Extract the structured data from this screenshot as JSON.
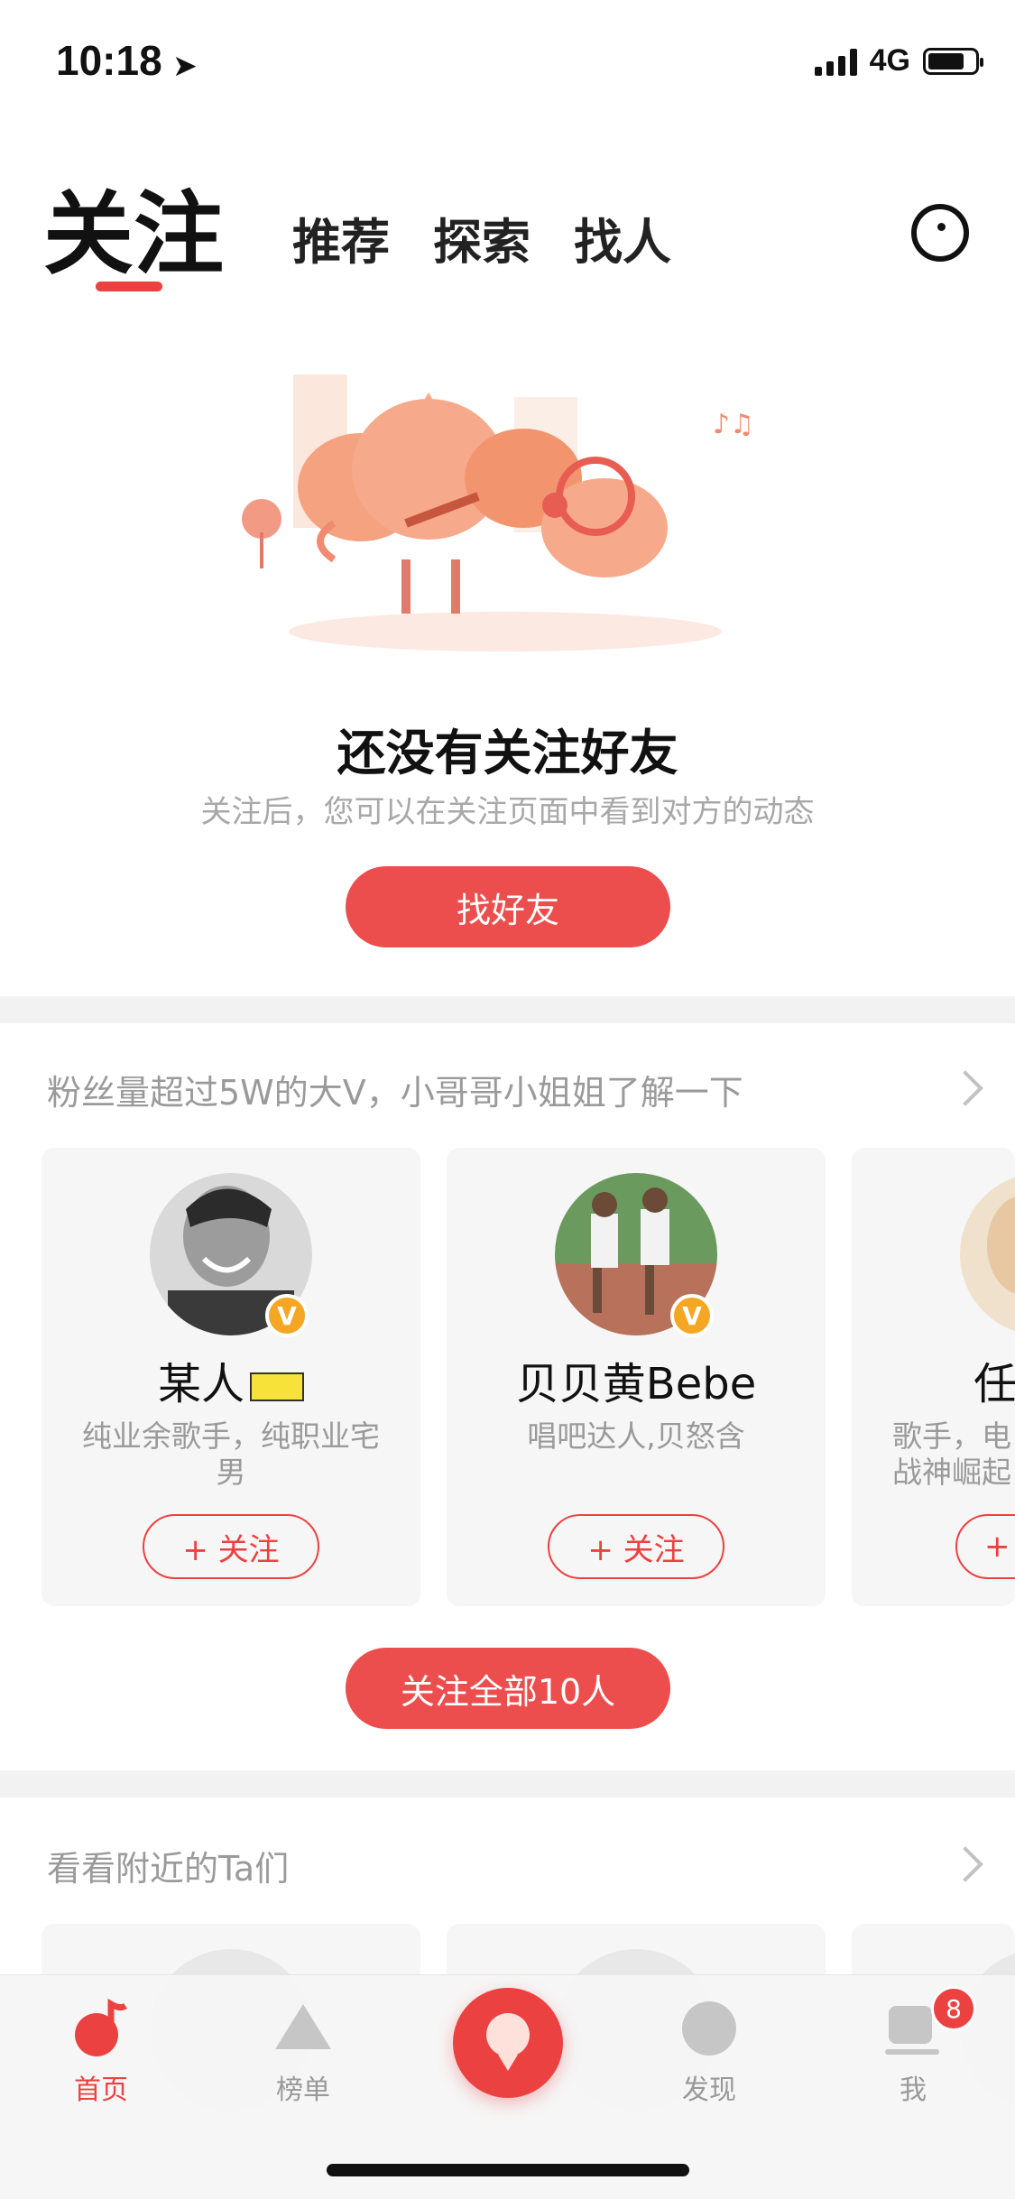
{
  "status_bar": {
    "time": "10:18",
    "network": "4G",
    "battery_level": 0.7
  },
  "tabs": {
    "active": "关注",
    "items": [
      "推荐",
      "探索",
      "找人"
    ]
  },
  "empty_state": {
    "title": "还没有关注好友",
    "subtitle": "关注后，您可以在关注页面中看到对方的动态",
    "button": "找好友"
  },
  "recommend": {
    "title": "粉丝量超过5W的大V，小哥哥小姐姐了解一下",
    "cards": [
      {
        "name": "某人",
        "desc": "纯业余歌手，纯职业宅男",
        "follow": "+ 关注",
        "verified": "V"
      },
      {
        "name": "贝贝黄Bebe",
        "desc": "唱吧达人,贝怒含",
        "follow": "+ 关注",
        "verified": "V"
      },
      {
        "name": "任",
        "desc": "歌手，电战神崛起",
        "follow": "+",
        "verified": ""
      }
    ],
    "follow_all": "关注全部10人"
  },
  "nearby": {
    "title": "看看附近的Ta们"
  },
  "bottom_nav": {
    "items": [
      {
        "label": "首页",
        "icon": "music-note-icon",
        "active": true
      },
      {
        "label": "榜单",
        "icon": "triangle-chart-icon",
        "active": false
      },
      {
        "label": "",
        "icon": "microphone-icon",
        "active": false
      },
      {
        "label": "发现",
        "icon": "circle-discover-icon",
        "active": false
      },
      {
        "label": "我",
        "icon": "profile-cup-icon",
        "active": false,
        "badge": "8"
      }
    ]
  },
  "colors": {
    "accent": "#ec4141",
    "verified": "#f5a623",
    "muted": "#9a9a9a"
  }
}
